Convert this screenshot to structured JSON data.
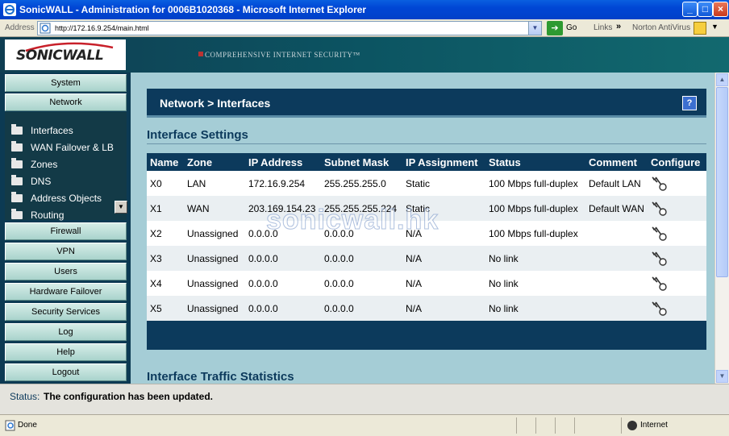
{
  "window": {
    "title": "SonicWALL - Administration for 0006B1020368 - Microsoft Internet Explorer",
    "minimize": "_",
    "maximize": "□",
    "close": "×"
  },
  "addressbar": {
    "label": "Address",
    "url": "http://172.16.9.254/main.html",
    "go": "Go",
    "links": "Links",
    "links_chevron": "»",
    "norton": "Norton AntiVirus"
  },
  "banner": {
    "logo": "SONICWALL",
    "tagline": "COMPREHENSIVE INTERNET SECURITY™"
  },
  "nav": {
    "top_items": [
      "System",
      "Network"
    ],
    "sub_items": [
      "Interfaces",
      "WAN Failover & LB",
      "Zones",
      "DNS",
      "Address Objects",
      "Routing"
    ],
    "bottom_items": [
      "Firewall",
      "VPN",
      "Users",
      "Hardware Failover",
      "Security Services",
      "Log",
      "Help",
      "Logout"
    ]
  },
  "page": {
    "title": "Network > Interfaces",
    "help": "?",
    "section1": "Interface Settings",
    "section2": "Interface Traffic Statistics"
  },
  "table": {
    "columns": [
      "Name",
      "Zone",
      "IP Address",
      "Subnet Mask",
      "IP Assignment",
      "Status",
      "Comment",
      "Configure"
    ],
    "rows": [
      {
        "name": "X0",
        "zone": "LAN",
        "ip": "172.16.9.254",
        "mask": "255.255.255.0",
        "assign": "Static",
        "status": "100 Mbps full-duplex",
        "comment": "Default LAN"
      },
      {
        "name": "X1",
        "zone": "WAN",
        "ip": "203.169.154.23",
        "mask": "255.255.255.224",
        "assign": "Static",
        "status": "100 Mbps full-duplex",
        "comment": "Default WAN"
      },
      {
        "name": "X2",
        "zone": "Unassigned",
        "ip": "0.0.0.0",
        "mask": "0.0.0.0",
        "assign": "N/A",
        "status": "100 Mbps full-duplex",
        "comment": ""
      },
      {
        "name": "X3",
        "zone": "Unassigned",
        "ip": "0.0.0.0",
        "mask": "0.0.0.0",
        "assign": "N/A",
        "status": "No link",
        "comment": ""
      },
      {
        "name": "X4",
        "zone": "Unassigned",
        "ip": "0.0.0.0",
        "mask": "0.0.0.0",
        "assign": "N/A",
        "status": "No link",
        "comment": ""
      },
      {
        "name": "X5",
        "zone": "Unassigned",
        "ip": "0.0.0.0",
        "mask": "0.0.0.0",
        "assign": "N/A",
        "status": "No link",
        "comment": ""
      }
    ]
  },
  "watermark": "sonicwall.hk",
  "status": {
    "label": "Status:",
    "message": "The configuration has been updated."
  },
  "browser_status": {
    "done": "Done",
    "zone": "Internet"
  },
  "colors": {
    "nav_dark": "#0C3A53",
    "content_bg": "#A5CDD6",
    "header_navy": "#0C3A5C"
  }
}
